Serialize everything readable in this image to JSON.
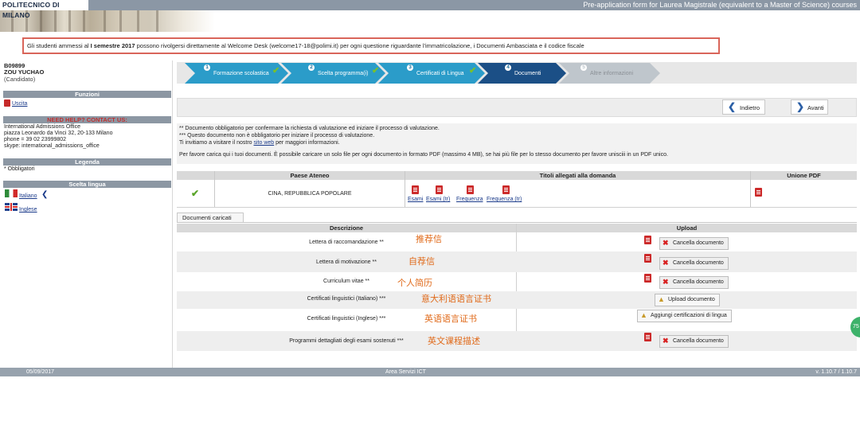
{
  "header": {
    "logo": "POLITECNICO DI MILANO",
    "title": "Pre-application form for Laurea Magistrale (equivalent to a Master of Science) courses"
  },
  "notice": {
    "pre": "Gli studenti ammessi al ",
    "bold": "I semestre 2017",
    "post": " possono rivolgersi direttamente al Welcome Desk (welcome17-18@polimi.it) per ogni questione riguardante l'immatricolazione, i Documenti Ambasciata e il codice fiscale"
  },
  "user": {
    "id": "B09899",
    "name": "ZOU YUCHAO",
    "role": "(Candidato)"
  },
  "sidebar": {
    "funzioni_title": "Funzioni",
    "uscita": "Uscita",
    "help_title": "NEED HELP? CONTACT US:",
    "help_lines": [
      "International Admissions Office",
      "piazza Leonardo da Vinci 32, 20-133 Milano",
      "phone = 39 02 23999802",
      "skype: international_admissions_office"
    ],
    "legenda_title": "Legenda",
    "legenda_text": "* Obbligatori",
    "lingua_title": "Scelta lingua",
    "lang_it": "Italiano",
    "lang_en": "Inglese"
  },
  "steps": [
    {
      "num": "1",
      "label": "Formazione scolastica",
      "done": true
    },
    {
      "num": "2",
      "label": "Scelta programma(i)",
      "done": true
    },
    {
      "num": "3",
      "label": "Certificati di Lingua",
      "done": true
    },
    {
      "num": "4",
      "label": "Documenti",
      "done": false
    },
    {
      "num": "5",
      "label": "Altre informazioni",
      "done": false
    }
  ],
  "toolbar": {
    "back": "Indietro",
    "next": "Avanti"
  },
  "info": {
    "line1": "** Documento obbligatorio per confermare la richiesta di valutazione ed iniziare il processo di valutazione.",
    "line2": "*** Questo documento non è obbligatorio per iniziare il processo di valutazione.",
    "line3_pre": "Ti invitiamo a visitare il nostro ",
    "line3_link": "sito web",
    "line3_post": " per maggiori informazioni.",
    "line4": "Per favore carica qui i tuoi documenti. È possibile caricare un solo file per ogni documento in formato PDF (massimo 4 MB), se hai più file per lo stesso documento per favore unisciii in un PDF unico."
  },
  "table1": {
    "headers": [
      "Paese Ateneo",
      "Titoli allegati alla domanda",
      "Unione PDF"
    ],
    "country": "CINA, REPUBBLICA POPOLARE",
    "files": [
      "Esami",
      "Esami (tr)",
      "Frequenza",
      "Frequenza (tr)"
    ]
  },
  "tab_label": "Documenti caricati",
  "table2": {
    "headers": [
      "Descrizione",
      "Upload"
    ],
    "rows": [
      {
        "desc": "Lettera di raccomandazione  **",
        "note": "推荐信",
        "has_pdf": true,
        "action": "Cancella documento",
        "kind": "delete"
      },
      {
        "desc": "Lettera di motivazione  **",
        "note": "自荐信",
        "has_pdf": true,
        "action": "Cancella documento",
        "kind": "delete"
      },
      {
        "desc": "Curriculum vitae  **",
        "note": "个人简历",
        "has_pdf": true,
        "action": "Cancella documento",
        "kind": "delete"
      },
      {
        "desc": "Certificati linguistici (Italiano)  ***",
        "note": "意大利语语言证书",
        "has_pdf": false,
        "action": "Upload documento",
        "kind": "upload"
      },
      {
        "desc": "Certificati linguistici (Inglese)  ***",
        "note": "英语语言证书",
        "has_pdf": false,
        "action": "Aggiungi certificazioni di lingua",
        "kind": "upload"
      },
      {
        "desc": "Programmi dettagliati degli esami sostenuti  ***",
        "note": "英文课程描述",
        "has_pdf": true,
        "action": "Cancella documento",
        "kind": "delete"
      }
    ]
  },
  "footer": {
    "date": "05/09/2017",
    "center": "Area Servizi ICT",
    "version": "v. 1.10.7 / 1.10.7"
  },
  "fab": "75"
}
